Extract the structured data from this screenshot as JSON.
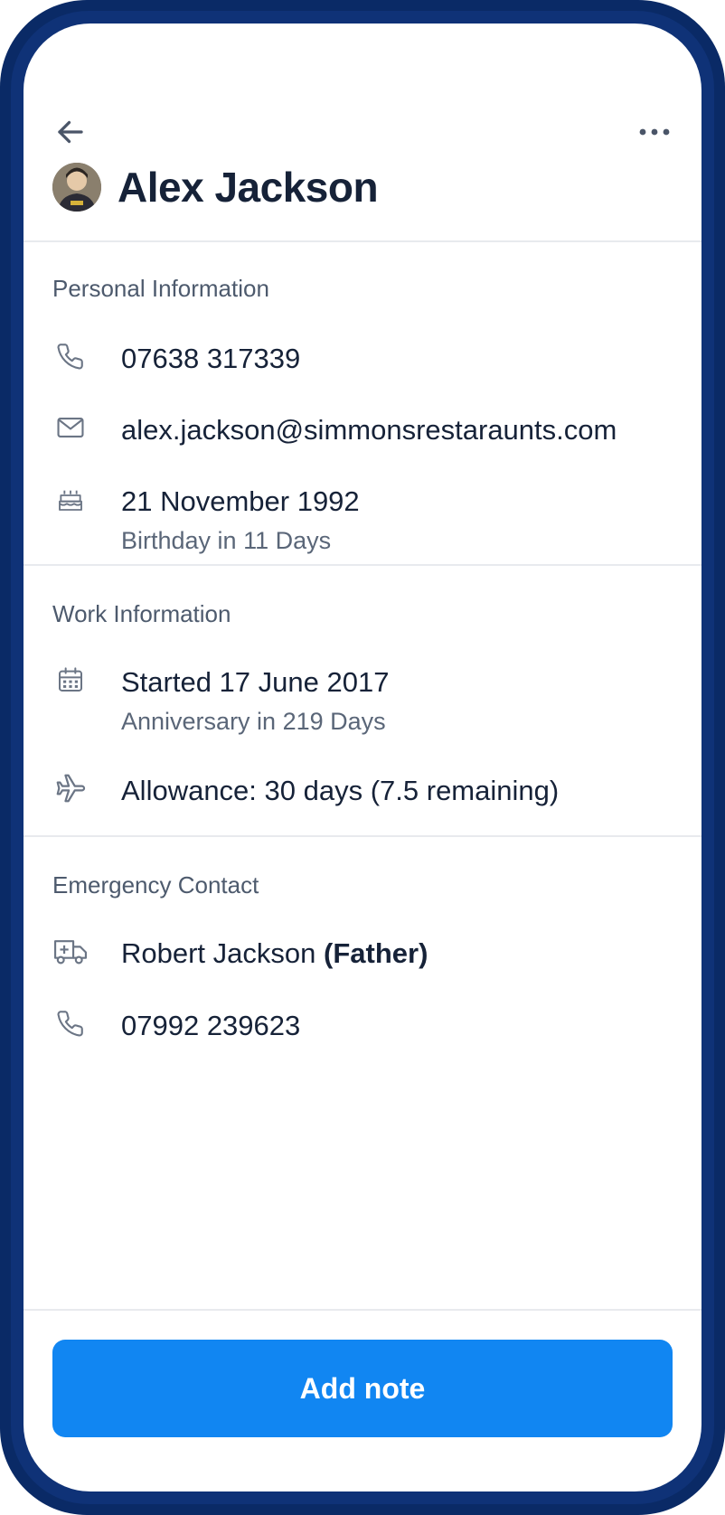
{
  "header": {
    "name": "Alex Jackson",
    "icons": {
      "back": "arrow-left-icon",
      "more": "more-horizontal-icon"
    }
  },
  "personal": {
    "title": "Personal Information",
    "phone": "07638 317339",
    "email": "alex.jackson@simmonsrestaraunts.com",
    "birthday": "21 November 1992",
    "birthday_sub": "Birthday in 11 Days"
  },
  "work": {
    "title": "Work Information",
    "started": "Started 17 June 2017",
    "anniversary_sub": "Anniversary in 219 Days",
    "allowance": "Allowance: 30 days (7.5 remaining)"
  },
  "emergency": {
    "title": "Emergency Contact",
    "contact_name": "Robert Jackson",
    "relation": "(Father)",
    "phone": "07992 239623"
  },
  "footer": {
    "add_note_label": "Add note"
  },
  "colors": {
    "primary_button": "#1186f2",
    "text_dark": "#162238",
    "text_muted": "#5a6678",
    "device_frame": "#0a2a66"
  }
}
